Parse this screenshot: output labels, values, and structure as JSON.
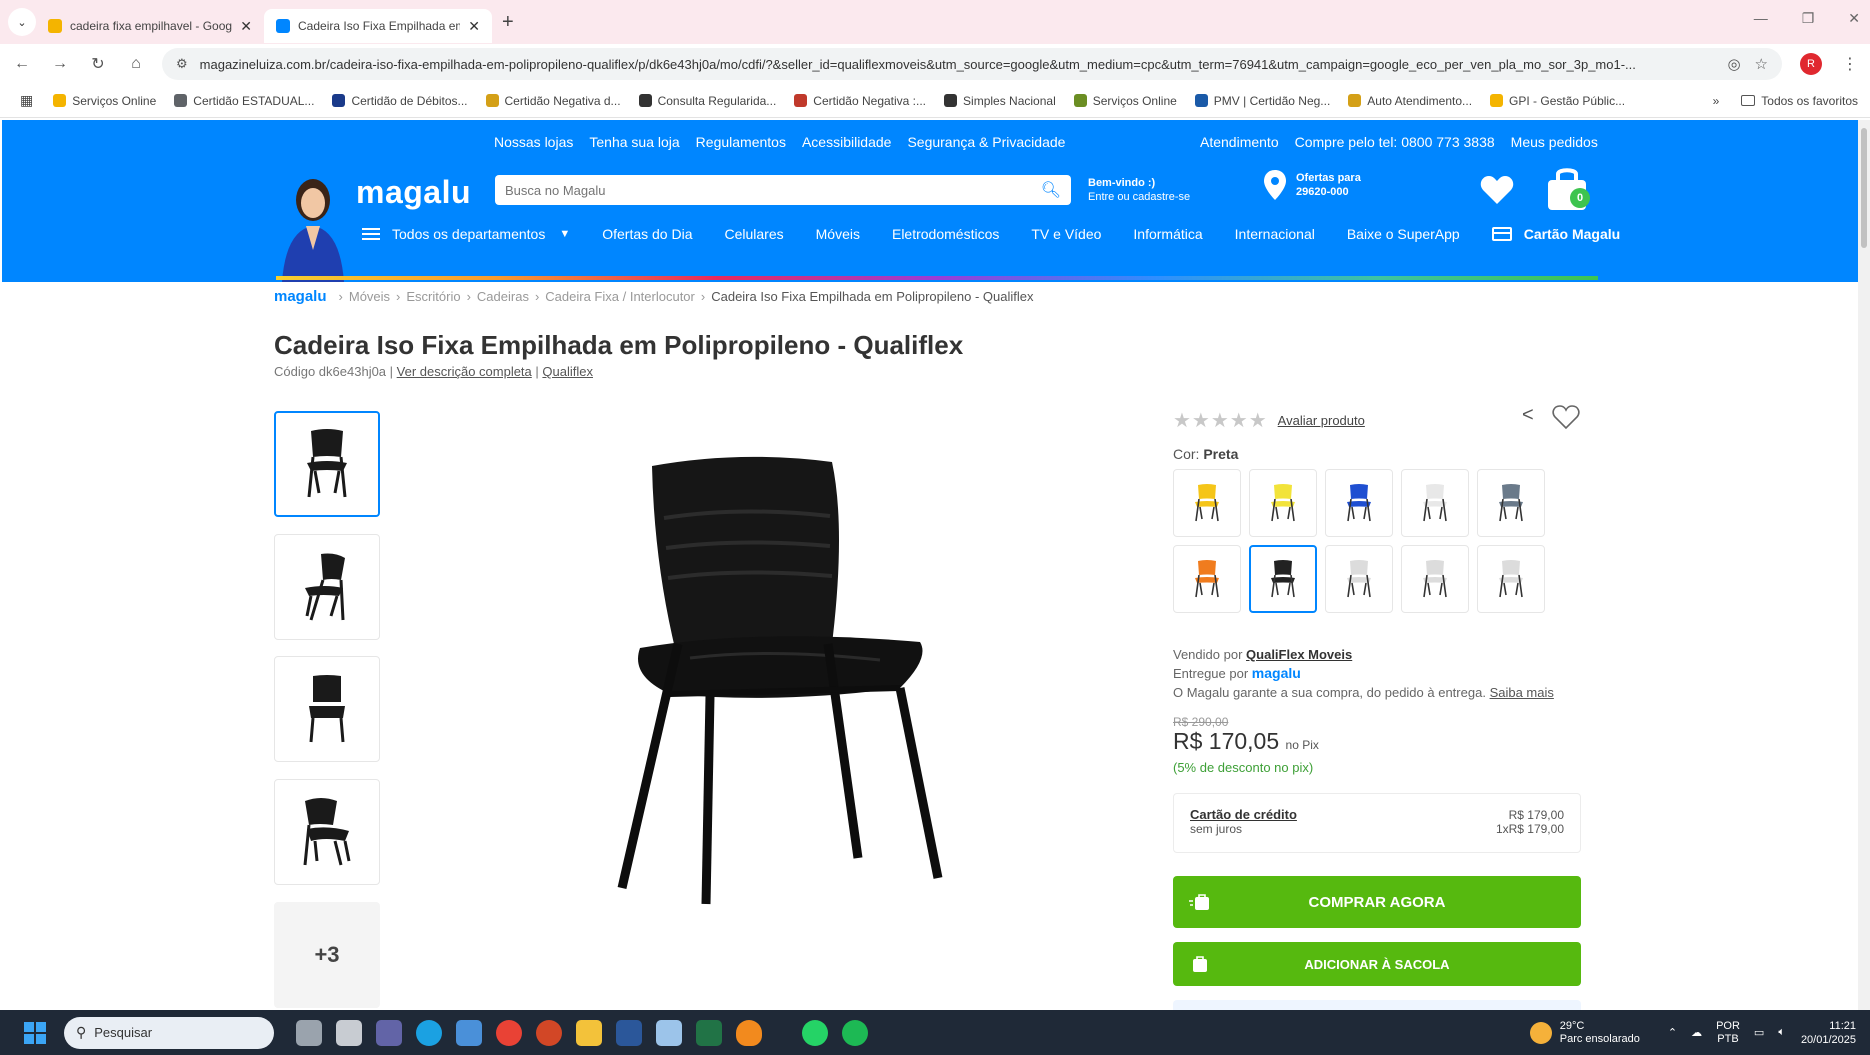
{
  "browser": {
    "tabs": [
      {
        "title": "cadeira fixa empilhavel - Googl",
        "fav_color": "#f4b400"
      },
      {
        "title": "Cadeira Iso Fixa Empilhada em",
        "fav_color": "#0086ff"
      }
    ],
    "url": "magazineluiza.com.br/cadeira-iso-fixa-empilhada-em-polipropileno-qualiflex/p/dk6e43hj0a/mo/cdfi/?&seller_id=qualiflexmoveis&utm_source=google&utm_medium=cpc&utm_term=76941&utm_campaign=google_eco_per_ven_pla_mo_sor_3p_mo1-...",
    "profile_initial": "R",
    "bookmarks": [
      {
        "label": "Serviços Online",
        "color": "#f4b400"
      },
      {
        "label": "Certidão ESTADUAL...",
        "color": "#5f6368"
      },
      {
        "label": "Certidão de Débitos...",
        "color": "#1a3a8a"
      },
      {
        "label": "Certidão Negativa d...",
        "color": "#d4a017"
      },
      {
        "label": "Consulta Regularida...",
        "color": "#333333"
      },
      {
        "label": "Certidão Negativa :...",
        "color": "#c0392b"
      },
      {
        "label": "Simples Nacional",
        "color": "#333333"
      },
      {
        "label": "Serviços Online",
        "color": "#6b8e23"
      },
      {
        "label": "PMV | Certidão Neg...",
        "color": "#1a5aa8"
      },
      {
        "label": "Auto Atendimento...",
        "color": "#d4a017"
      },
      {
        "label": "GPI - Gestão Públic...",
        "color": "#f4b400"
      }
    ],
    "bookmarks_more": "»",
    "all_bookmarks": "Todos os favoritos"
  },
  "header": {
    "top_links": [
      "Nossas lojas",
      "Tenha sua loja",
      "Regulamentos",
      "Acessibilidade",
      "Segurança & Privacidade"
    ],
    "top_links_right": [
      "Atendimento",
      "Compre pelo tel: 0800 773 3838",
      "Meus pedidos"
    ],
    "logo": "magalu",
    "search_placeholder": "Busca no Magalu",
    "welcome_line1": "Bem-vindo :)",
    "welcome_line2": "Entre ou cadastre-se",
    "location_line1": "Ofertas para",
    "location_line2": "29620-000",
    "bag_count": "0",
    "departments": "Todos os departamentos",
    "nav": [
      "Ofertas do Dia",
      "Celulares",
      "Móveis",
      "Eletrodomésticos",
      "TV e Vídeo",
      "Informática",
      "Internacional",
      "Baixe o SuperApp"
    ],
    "card": "Cartão Magalu"
  },
  "breadcrumb": {
    "logo": "magalu",
    "items": [
      "Móveis",
      "Escritório",
      "Cadeiras",
      "Cadeira Fixa / Interlocutor"
    ],
    "current": "Cadeira Iso Fixa Empilhada em Polipropileno - Qualiflex"
  },
  "product": {
    "title": "Cadeira Iso Fixa Empilhada em Polipropileno - Qualiflex",
    "code": "Código dk6e43hj0a |",
    "full_desc": "Ver descrição completa",
    "brand_sep": "|",
    "brand": "Qualiflex",
    "more_images": "+3",
    "rating_stars": "★★★★★",
    "rate_link": "Avaliar produto",
    "color_label": "Cor:",
    "color_value": "Preta",
    "swatches": [
      {
        "color": "#f5c518",
        "selected": false
      },
      {
        "color": "#f2e33a",
        "selected": false
      },
      {
        "color": "#1f4fd1",
        "selected": false
      },
      {
        "color": "#e8e8e8",
        "selected": false
      },
      {
        "color": "#6a7a8a",
        "selected": false
      },
      {
        "color": "#f07c1e",
        "selected": false
      },
      {
        "color": "#222222",
        "selected": true
      },
      {
        "color": "#dcdcdc",
        "selected": false
      },
      {
        "color": "#dcdcdc",
        "selected": false
      },
      {
        "color": "#dcdcdc",
        "selected": false
      }
    ],
    "sold_by_label": "Vendido por",
    "sold_by": "QualiFlex Moveis",
    "delivered_label": "Entregue por",
    "delivered_by": "magalu",
    "guarantee": "O Magalu garante a sua compra, do pedido à entrega.",
    "guarantee_link": "Saiba mais",
    "old_price": "R$ 290,00",
    "price": "R$ 170,05",
    "price_suffix": "no Pix",
    "pix_discount": "(5% de desconto no pix)",
    "credit_label": "Cartão de crédito",
    "credit_sub": "sem juros",
    "credit_total": "R$ 179,00",
    "credit_install": "1xR$ 179,00",
    "buy_now": "COMPRAR AGORA",
    "add_bag": "ADICIONAR À SACOLA"
  },
  "taskbar": {
    "search": "Pesquisar",
    "weather_temp": "29°C",
    "weather_desc": "Parc ensolarado",
    "lang1": "POR",
    "lang2": "PTB",
    "time": "11:21",
    "date": "20/01/2025"
  }
}
